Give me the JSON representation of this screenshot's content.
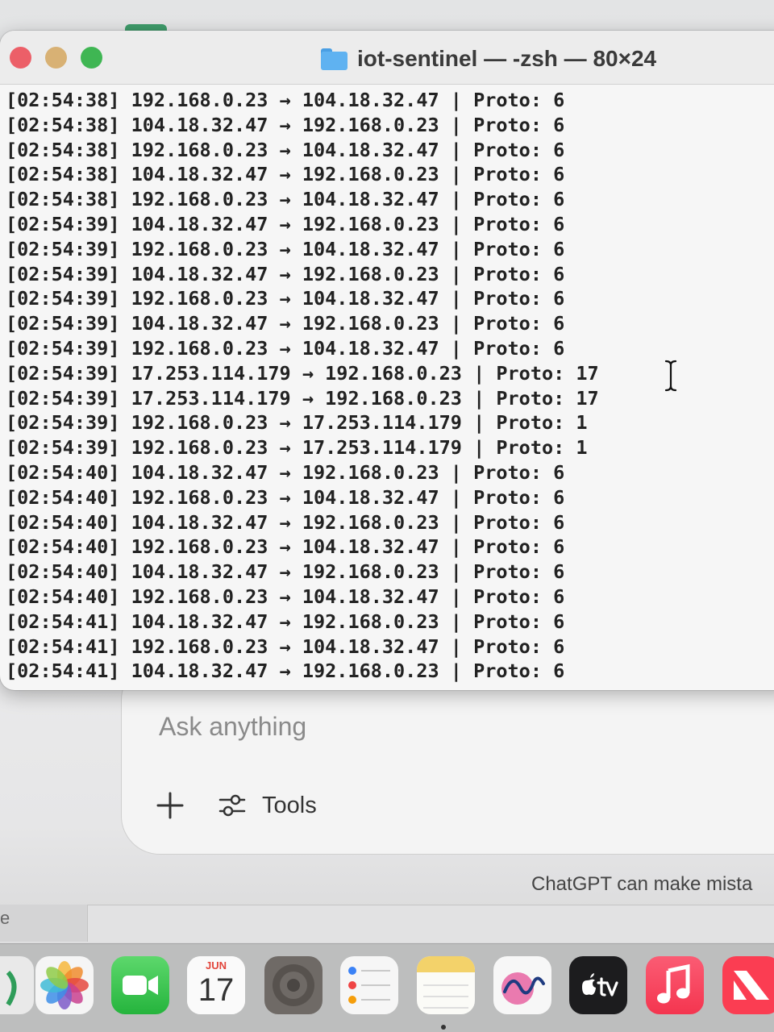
{
  "terminal": {
    "title": "iot-sentinel — -zsh — 80×24",
    "lines": [
      "[02:54:38] 192.168.0.23 → 104.18.32.47 | Proto: 6",
      "[02:54:38] 104.18.32.47 → 192.168.0.23 | Proto: 6",
      "[02:54:38] 192.168.0.23 → 104.18.32.47 | Proto: 6",
      "[02:54:38] 104.18.32.47 → 192.168.0.23 | Proto: 6",
      "[02:54:38] 192.168.0.23 → 104.18.32.47 | Proto: 6",
      "[02:54:39] 104.18.32.47 → 192.168.0.23 | Proto: 6",
      "[02:54:39] 192.168.0.23 → 104.18.32.47 | Proto: 6",
      "[02:54:39] 104.18.32.47 → 192.168.0.23 | Proto: 6",
      "[02:54:39] 192.168.0.23 → 104.18.32.47 | Proto: 6",
      "[02:54:39] 104.18.32.47 → 192.168.0.23 | Proto: 6",
      "[02:54:39] 192.168.0.23 → 104.18.32.47 | Proto: 6",
      "[02:54:39] 17.253.114.179 → 192.168.0.23 | Proto: 17",
      "[02:54:39] 17.253.114.179 → 192.168.0.23 | Proto: 17",
      "[02:54:39] 192.168.0.23 → 17.253.114.179 | Proto: 1",
      "[02:54:39] 192.168.0.23 → 17.253.114.179 | Proto: 1",
      "[02:54:40] 104.18.32.47 → 192.168.0.23 | Proto: 6",
      "[02:54:40] 192.168.0.23 → 104.18.32.47 | Proto: 6",
      "[02:54:40] 104.18.32.47 → 192.168.0.23 | Proto: 6",
      "[02:54:40] 192.168.0.23 → 104.18.32.47 | Proto: 6",
      "[02:54:40] 104.18.32.47 → 192.168.0.23 | Proto: 6",
      "[02:54:40] 192.168.0.23 → 104.18.32.47 | Proto: 6",
      "[02:54:41] 104.18.32.47 → 192.168.0.23 | Proto: 6",
      "[02:54:41] 192.168.0.23 → 104.18.32.47 | Proto: 6",
      "[02:54:41] 104.18.32.47 → 192.168.0.23 | Proto: 6"
    ]
  },
  "chat": {
    "placeholder": "Ask anything",
    "tools_label": "Tools",
    "disclaimer": "ChatGPT can make mista"
  },
  "left_strip_text": "e",
  "dock": {
    "calendar_month": "JUN",
    "calendar_day": "17",
    "apps": [
      "photos-icon",
      "facetime-icon",
      "calendar-icon",
      "settings-icon",
      "reminders-icon",
      "notes-icon",
      "freeform-icon",
      "apple-tv-icon",
      "music-icon",
      "news-icon"
    ]
  },
  "colors": {
    "close": "#ec5f68",
    "minimize": "#d8b174",
    "zoom": "#3fb653",
    "folder": "#5fb2f1"
  }
}
